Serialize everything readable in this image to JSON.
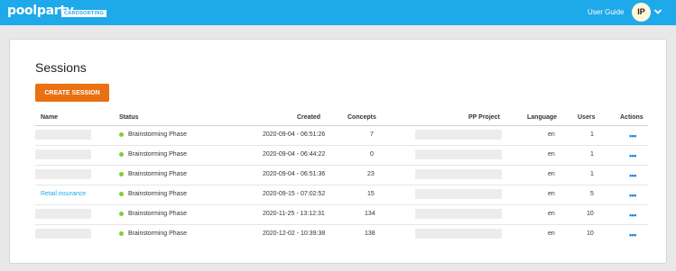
{
  "header": {
    "logo": "poolparty",
    "logo_badge": "CARDSORTING",
    "user_guide": "User Guide",
    "avatar_initials": "IP",
    "bar_color": "#1ea9ea"
  },
  "main": {
    "title": "Sessions",
    "create_button": "CREATE SESSION",
    "button_color": "#ea7012"
  },
  "table": {
    "columns": [
      "Name",
      "Status",
      "Created",
      "Concepts",
      "PP Project",
      "Language",
      "Users",
      "Actions"
    ],
    "rows": [
      {
        "name": "",
        "status": "Brainstorming Phase",
        "created": "2020-09-04 - 06:51:26",
        "concepts": "7",
        "project": "",
        "language": "en",
        "users": "1",
        "actions": "•••"
      },
      {
        "name": "",
        "status": "Brainstorming Phase",
        "created": "2020-09-04 - 06:44:22",
        "concepts": "0",
        "project": "",
        "language": "en",
        "users": "1",
        "actions": "•••"
      },
      {
        "name": "",
        "status": "Brainstorming Phase",
        "created": "2020-09-04 - 06:51:36",
        "concepts": "23",
        "project": "",
        "language": "en",
        "users": "1",
        "actions": "•••"
      },
      {
        "name": "Retail insurance",
        "status": "Brainstorming Phase",
        "created": "2020-09-15 - 07:02:52",
        "concepts": "15",
        "project": "",
        "language": "en",
        "users": "5",
        "actions": "•••"
      },
      {
        "name": "",
        "status": "Brainstorming Phase",
        "created": "2020-11-25 - 13:12:31",
        "concepts": "134",
        "project": "",
        "language": "en",
        "users": "10",
        "actions": "•••"
      },
      {
        "name": "",
        "status": "Brainstorming Phase",
        "created": "2020-12-02 - 10:39:38",
        "concepts": "138",
        "project": "",
        "language": "en",
        "users": "10",
        "actions": "•••"
      }
    ],
    "status_color": "#76d13a"
  }
}
